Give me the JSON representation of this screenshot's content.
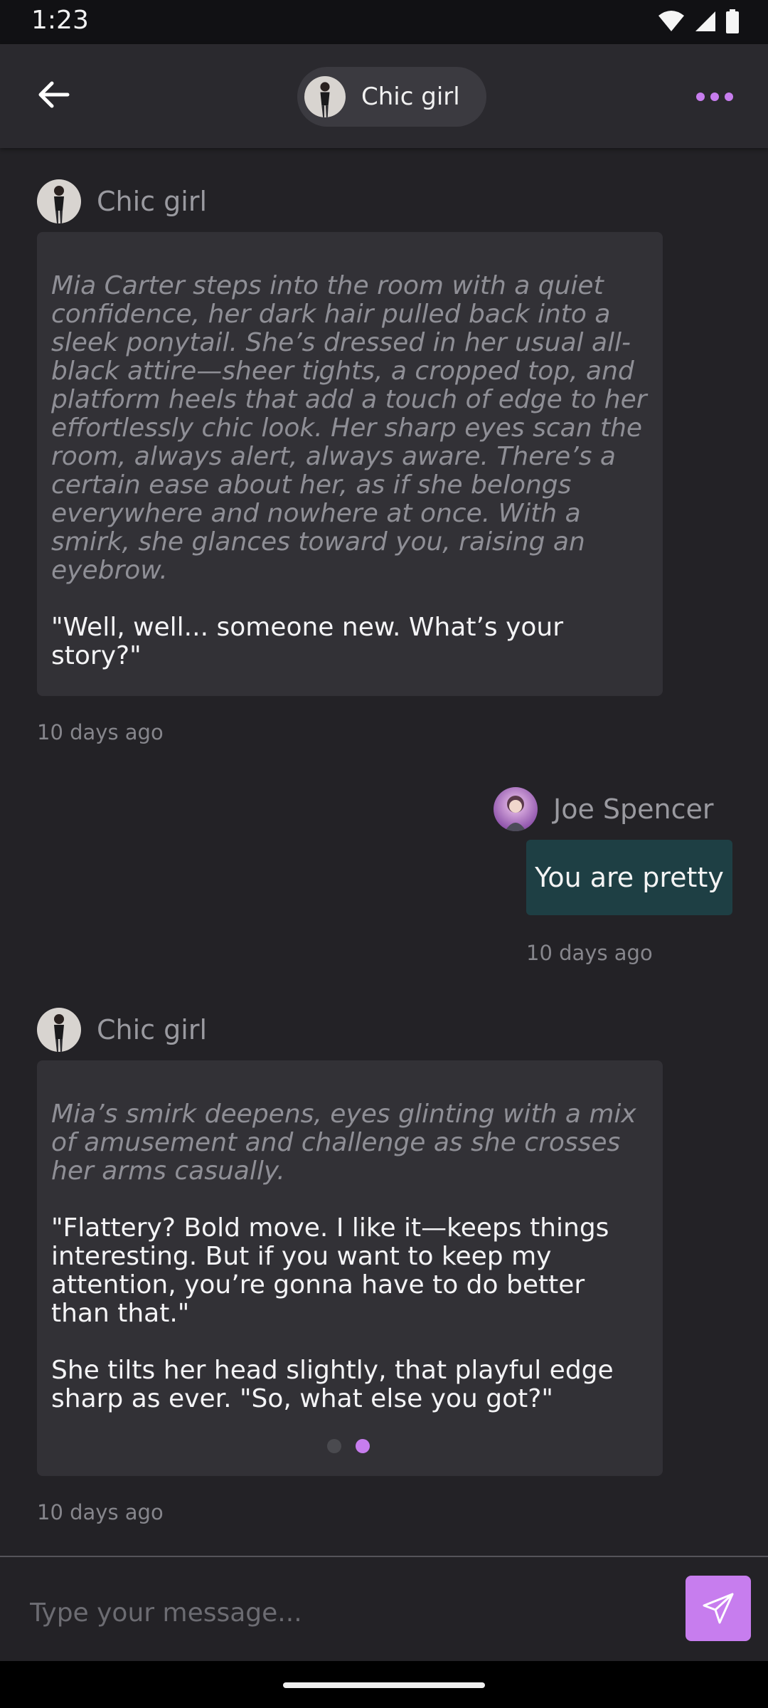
{
  "status_bar": {
    "time": "1:23",
    "icons": [
      "wifi-icon",
      "cellular-signal-icon",
      "battery-icon"
    ]
  },
  "header": {
    "title": "Chic girl",
    "back_icon": "arrow-left-icon",
    "menu_icon": "more-horizontal-icon",
    "accent_color": "#c77dee"
  },
  "messages": [
    {
      "author": "Chic girl",
      "paragraphs": [
        {
          "style": "narration",
          "text": "Mia Carter steps into the room with a quiet confidence, her dark hair pulled back into a sleek ponytail. She’s dressed in her usual all-black attire—sheer tights, a cropped top, and platform heels that add a touch of edge to her effortlessly chic look. Her sharp eyes scan the room, always alert, always aware. There’s a certain ease about her, as if she belongs everywhere and nowhere at once. With a smirk, she glances toward you, raising an eyebrow."
        },
        {
          "style": "speech",
          "text": "\"Well, well... someone new. What’s your story?\""
        }
      ],
      "timestamp": "10 days ago"
    },
    {
      "author": "Joe Spencer",
      "text": "You are pretty",
      "timestamp": "10 days ago"
    },
    {
      "author": "Chic girl",
      "paragraphs": [
        {
          "style": "narration",
          "text": "Mia’s smirk deepens, eyes glinting with a mix of amusement and challenge as she crosses her arms casually."
        },
        {
          "style": "speech",
          "text": "\"Flattery? Bold move. I like it—keeps things interesting. But if you want to keep my attention, you’re gonna have to do better than that.\""
        },
        {
          "style": "speech",
          "text": "She tilts her head slightly, that playful edge sharp as ever. \"So, what else you got?\""
        }
      ],
      "pagination": {
        "total": 2,
        "current": 2
      },
      "timestamp": "10 days ago"
    }
  ],
  "composer": {
    "placeholder": "Type your message...",
    "value": "",
    "send_icon": "send-icon"
  }
}
